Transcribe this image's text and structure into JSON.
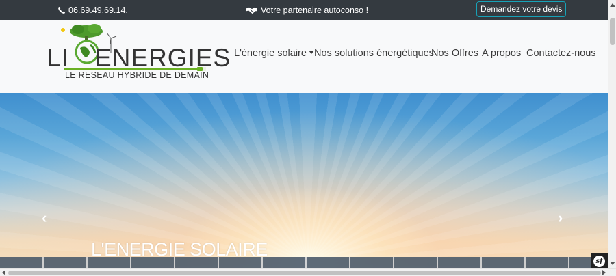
{
  "topbar": {
    "phone": "06.69.49.69.14.",
    "tagline": "Votre partenaire autoconso !",
    "quote_button": "Demandez votre devis"
  },
  "logo": {
    "word1": "LI",
    "word2": "ENERGIES",
    "subtitle": "LE RESEAU HYBRIDE DE DEMAIN",
    "accent_color": "#6ab023"
  },
  "nav": {
    "items": [
      {
        "label": "L'énergie solaire",
        "has_dropdown": true
      },
      {
        "label": "Nos solutions énergétiques"
      },
      {
        "label": "Nos Offres"
      },
      {
        "label": "A propos"
      },
      {
        "label": "Contactez-nous"
      }
    ]
  },
  "hero": {
    "caption": "L'ENERGIE SOLAIRE",
    "prev_icon": "chevron-left-icon",
    "next_icon": "chevron-right-icon"
  },
  "colors": {
    "topbar_bg": "#343a40",
    "header_bg": "#f8f9fa",
    "button_border": "#17a2b8"
  }
}
